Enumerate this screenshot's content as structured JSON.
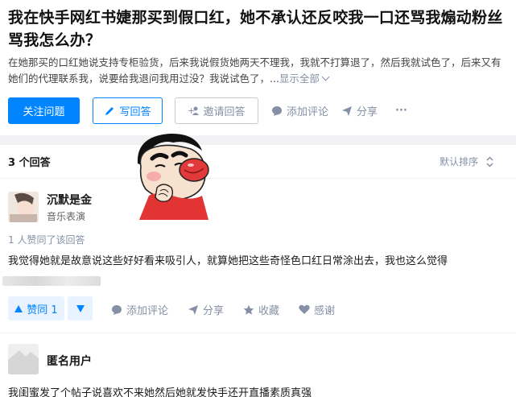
{
  "question": {
    "title": "我在快手网红书婕那买到假口红，她不承认还反咬我一口还骂我煽动粉丝骂我怎么办？",
    "desc": "在她那买的口红她说支持专柜验货，后来我说假货她两天不理我，我就不打算退了，然后我就试色了，后来又有她们的代理联系我，说要给我退问我用过没？我说试色了，...",
    "show_all": "显示全部"
  },
  "actions": {
    "follow": "关注问题",
    "write": "写回答",
    "invite": "邀请回答",
    "comment": "添加评论",
    "share": "分享",
    "more": "···"
  },
  "answers_header": {
    "count": "3 个回答",
    "sort": "默认排序"
  },
  "answer1": {
    "name": "沉默是金",
    "headline": "音乐表演",
    "liked": "1 人赞同了该回答",
    "text": "我觉得她就是故意说这些好好看来吸引人，就算她把这些奇怪色口红日常涂出去，我也这么觉得",
    "vote": "赞同 1",
    "comment": "添加评论",
    "share": "分享",
    "collect": "收藏",
    "thanks": "感谢"
  },
  "answer2": {
    "name": "匿名用户",
    "text": "我闺蜜发了个帖子说喜欢不来她然后她就发快手还开直播素质真强"
  },
  "colors": {
    "primary": "#0084ff",
    "muted": "#8590a6"
  }
}
